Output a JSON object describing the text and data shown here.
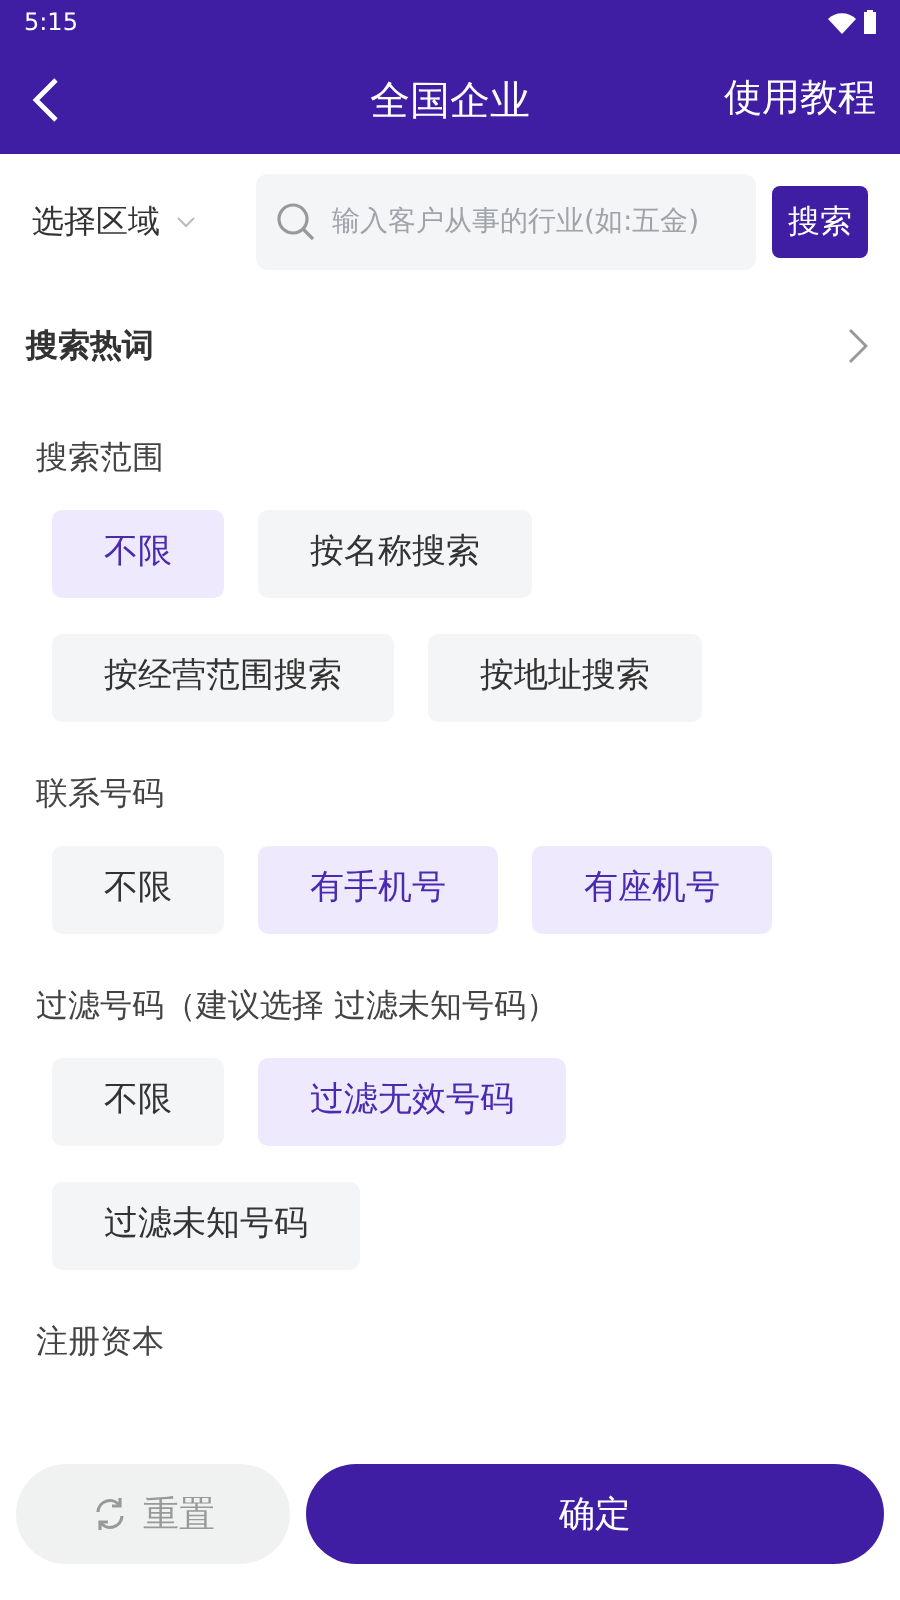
{
  "status_bar": {
    "time": "5:15"
  },
  "header": {
    "title": "全国企业",
    "action": "使用教程"
  },
  "search": {
    "region": "选择区域",
    "placeholder": "输入客户从事的行业(如:五金)",
    "button": "搜索"
  },
  "hot_words": {
    "label": "搜索热词"
  },
  "filters": [
    {
      "title": "搜索范围",
      "options": [
        {
          "label": "不限",
          "selected": true
        },
        {
          "label": "按名称搜索",
          "selected": false
        },
        {
          "label": "按经营范围搜索",
          "selected": false
        },
        {
          "label": "按地址搜索",
          "selected": false
        }
      ]
    },
    {
      "title": "联系号码",
      "options": [
        {
          "label": "不限",
          "selected": false
        },
        {
          "label": "有手机号",
          "selected": true
        },
        {
          "label": "有座机号",
          "selected": true
        }
      ]
    },
    {
      "title": "过滤号码（建议选择 过滤未知号码）",
      "options": [
        {
          "label": "不限",
          "selected": false
        },
        {
          "label": "过滤无效号码",
          "selected": true
        },
        {
          "label": "过滤未知号码",
          "selected": false
        }
      ]
    },
    {
      "title": "注册资本"
    }
  ],
  "footer": {
    "reset": "重置",
    "confirm": "确定"
  }
}
